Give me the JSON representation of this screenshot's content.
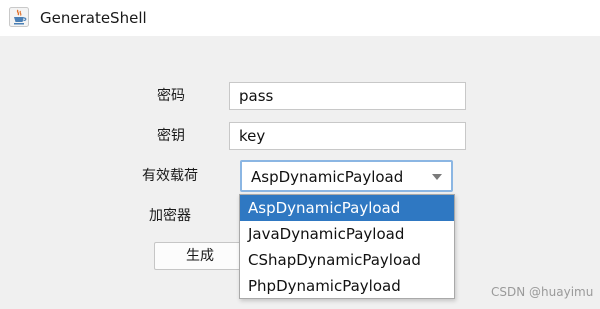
{
  "window": {
    "title": "GenerateShell",
    "icon": "java-cup-icon"
  },
  "form": {
    "password": {
      "label": "密码",
      "value": "pass"
    },
    "secret_key": {
      "label": "密钥",
      "value": "key"
    },
    "payload": {
      "label": "有效载荷",
      "selected": "AspDynamicPayload",
      "options": [
        "AspDynamicPayload",
        "JavaDynamicPayload",
        "CShapDynamicPayload",
        "PhpDynamicPayload"
      ],
      "highlighted_index": 0
    },
    "encryptor": {
      "label": "加密器"
    },
    "generate_button": "生成"
  },
  "watermark": "CSDN @huayimu",
  "colors": {
    "selection": "#2f78c2",
    "focus_border": "#8bb6e3",
    "background": "#f0f0f0"
  }
}
